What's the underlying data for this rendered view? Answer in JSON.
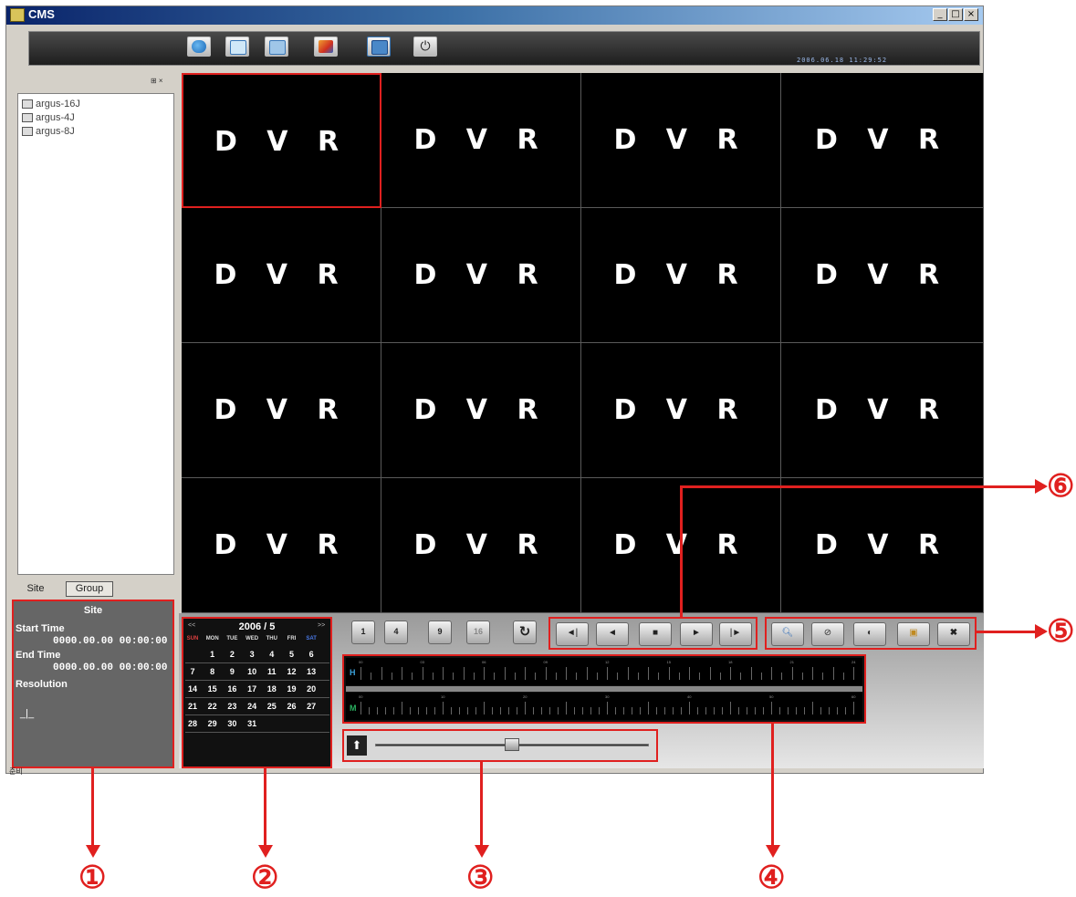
{
  "app": {
    "title": "CMS"
  },
  "window_controls": [
    "_",
    "□",
    "×"
  ],
  "toolbar": {
    "buttons": [
      "live-view",
      "playback",
      "search",
      "setup",
      "backup",
      "power"
    ],
    "clock": "2006.06.18 11:29:52"
  },
  "site_tree": {
    "items": [
      "argus-16J",
      "argus-4J",
      "argus-8J"
    ]
  },
  "tabs": {
    "site": "Site",
    "group": "Group"
  },
  "info_panel": {
    "header": "Site",
    "start_time_label": "Start Time",
    "start_time_value": "0000.00.00 00:00:00",
    "end_time_label": "End Time",
    "end_time_value": "0000.00.00 00:00:00",
    "resolution_label": "Resolution",
    "resolution_value": "_|_"
  },
  "status_bar": {
    "text": "준비"
  },
  "grid": {
    "cell_label": "D V R",
    "cells": 16
  },
  "calendar": {
    "prev": "<<",
    "next": ">>",
    "title": "2006 / 5",
    "weekdays": [
      "SUN",
      "MON",
      "TUE",
      "WED",
      "THU",
      "FRI",
      "SAT"
    ],
    "weeks": [
      [
        "",
        "1",
        "2",
        "3",
        "4",
        "5",
        "6"
      ],
      [
        "7",
        "8",
        "9",
        "10",
        "11",
        "12",
        "13"
      ],
      [
        "14",
        "15",
        "16",
        "17",
        "18",
        "19",
        "20"
      ],
      [
        "21",
        "22",
        "23",
        "24",
        "25",
        "26",
        "27"
      ],
      [
        "28",
        "29",
        "30",
        "31",
        "",
        "",
        ""
      ]
    ]
  },
  "channel_buttons": [
    "1",
    "4",
    "9",
    "16"
  ],
  "playback_buttons": [
    "◄|",
    "◄",
    "■",
    "►",
    "|►"
  ],
  "tool_buttons": [
    "zoom",
    "snapshot",
    "speaker",
    "save",
    "close"
  ],
  "timeline": {
    "hour_label": "H",
    "minute_label": "M",
    "hour_ticks": [
      "00",
      "03",
      "06",
      "09",
      "12",
      "15",
      "18",
      "21",
      "24"
    ],
    "minute_ticks": [
      "00",
      "10",
      "20",
      "30",
      "40",
      "50",
      "60"
    ]
  },
  "slider": {
    "value": 0.5
  },
  "callouts": [
    "①",
    "②",
    "③",
    "④",
    "⑤",
    "⑥"
  ],
  "colors": {
    "accent": "#e0201f",
    "screen": "#000000",
    "chrome": "#d4d0c8"
  }
}
